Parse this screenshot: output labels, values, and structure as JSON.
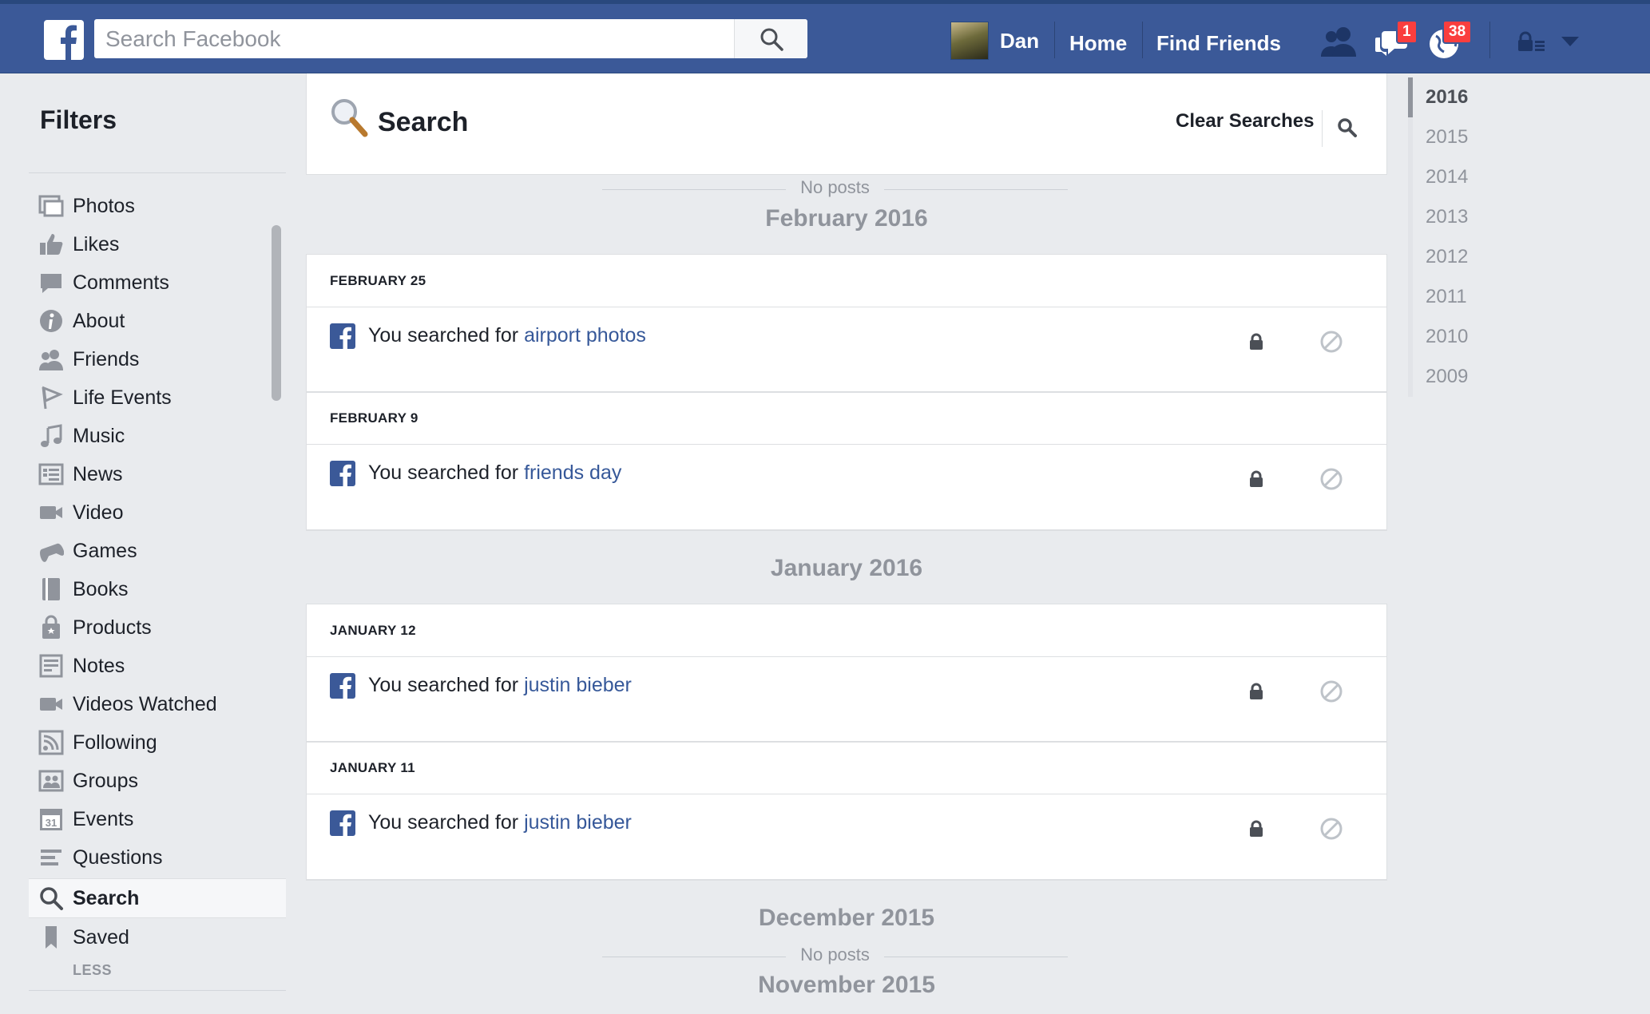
{
  "topbar": {
    "search_placeholder": "Search Facebook",
    "user_name": "Dan",
    "home": "Home",
    "find_friends": "Find Friends",
    "messages_badge": "1",
    "notifications_badge": "38"
  },
  "filters": {
    "title": "Filters",
    "items": [
      {
        "label": "Photos",
        "icon": "photos-icon"
      },
      {
        "label": "Likes",
        "icon": "thumbs-up-icon"
      },
      {
        "label": "Comments",
        "icon": "comment-icon"
      },
      {
        "label": "About",
        "icon": "info-icon"
      },
      {
        "label": "Friends",
        "icon": "friends-icon"
      },
      {
        "label": "Life Events",
        "icon": "flag-icon"
      },
      {
        "label": "Music",
        "icon": "music-note-icon"
      },
      {
        "label": "News",
        "icon": "news-icon"
      },
      {
        "label": "Video",
        "icon": "video-camera-icon"
      },
      {
        "label": "Games",
        "icon": "gamepad-icon"
      },
      {
        "label": "Books",
        "icon": "book-icon"
      },
      {
        "label": "Products",
        "icon": "shopping-bag-icon"
      },
      {
        "label": "Notes",
        "icon": "note-icon"
      },
      {
        "label": "Videos Watched",
        "icon": "video-camera-icon"
      },
      {
        "label": "Following",
        "icon": "rss-icon"
      },
      {
        "label": "Groups",
        "icon": "groups-icon"
      },
      {
        "label": "Events",
        "icon": "calendar-icon"
      },
      {
        "label": "Questions",
        "icon": "questions-icon"
      },
      {
        "label": "Search",
        "icon": "search-icon"
      },
      {
        "label": "Saved",
        "icon": "bookmark-icon"
      }
    ],
    "active": "Search",
    "less": "LESS"
  },
  "main": {
    "title": "Search",
    "clear_searches": "Clear Searches",
    "no_posts": "No posts",
    "months": [
      "February 2016",
      "January 2016",
      "December 2015",
      "November 2015"
    ],
    "feb_days": [
      {
        "date": "FEBRUARY 25",
        "prefix": "You searched for",
        "query": "airport photos"
      },
      {
        "date": "FEBRUARY 9",
        "prefix": "You searched for",
        "query": "friends day"
      }
    ],
    "jan_days": [
      {
        "date": "JANUARY 12",
        "prefix": "You searched for",
        "query": "justin bieber"
      },
      {
        "date": "JANUARY 11",
        "prefix": "You searched for",
        "query": "justin bieber"
      }
    ]
  },
  "years": [
    "2016",
    "2015",
    "2014",
    "2013",
    "2012",
    "2011",
    "2010",
    "2009"
  ],
  "active_year": "2016",
  "colors": {
    "brand_blue": "#3b5998",
    "link_blue": "#365899",
    "badge_red": "#fa3e3e",
    "page_bg": "#e9ebee"
  }
}
